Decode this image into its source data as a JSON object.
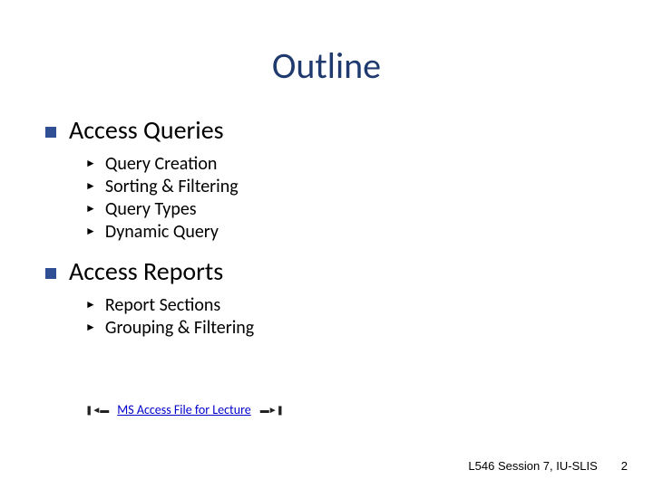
{
  "title": "Outline",
  "sections": [
    {
      "heading": "Access Queries",
      "items": [
        "Query Creation",
        "Sorting & Filtering",
        "Query Types",
        "Dynamic Query"
      ]
    },
    {
      "heading": "Access Reports",
      "items": [
        "Report Sections",
        "Grouping & Filtering"
      ]
    }
  ],
  "link": {
    "left_deco": "❚◄▬",
    "text": "MS Access File for Lecture",
    "right_deco": "▬►❚"
  },
  "footer": {
    "session": "L546 Session 7, IU-SLIS",
    "page": "2"
  }
}
